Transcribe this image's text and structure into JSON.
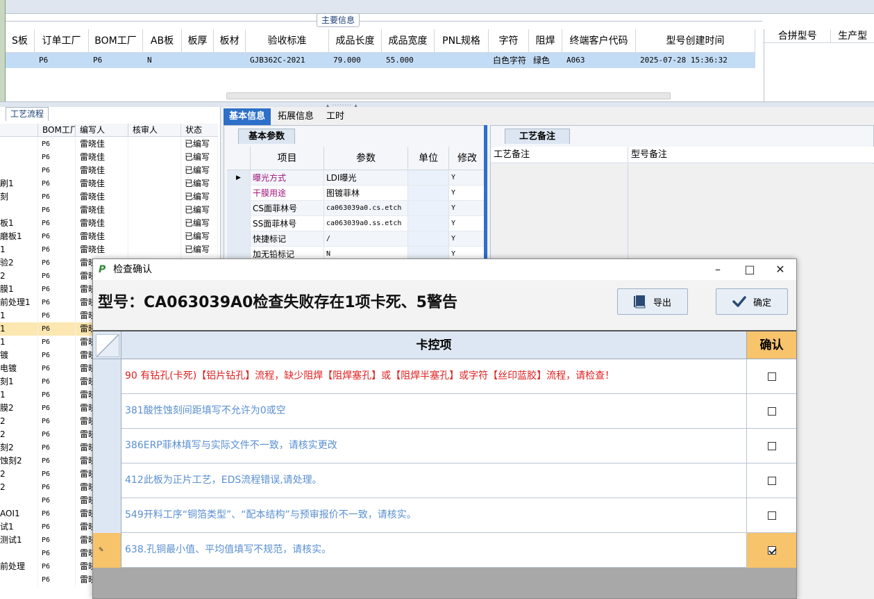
{
  "main_info": {
    "group_title": "主要信息",
    "headers": [
      "S板",
      "订单工厂",
      "BOM工厂",
      "AB板",
      "板厚",
      "板材",
      "验收标准",
      "成品长度",
      "成品宽度",
      "PNL规格",
      "字符",
      "阻焊",
      "终端客户代码",
      "型号创建时间"
    ],
    "row": [
      "",
      "P6",
      "P6",
      "N",
      "",
      "",
      "GJB362C-2021",
      "79.000",
      "55.000",
      "",
      "白色字符",
      "绿色",
      "A063",
      "2025-07-28 15:36:32"
    ],
    "right_headers": [
      "合拼型号",
      "生产型"
    ]
  },
  "process": {
    "tab": "工艺流程",
    "headers": [
      "",
      "BOM工厂",
      "编写人",
      "核审人",
      "状态"
    ],
    "rows": [
      [
        "",
        "P6",
        "雷晓佳",
        "",
        "已编写"
      ],
      [
        "",
        "P6",
        "雷晓佳",
        "",
        "已编写"
      ],
      [
        "",
        "P6",
        "雷晓佳",
        "",
        "已编写"
      ],
      [
        "刷1",
        "P6",
        "雷晓佳",
        "",
        "已编写"
      ],
      [
        "刻",
        "P6",
        "雷晓佳",
        "",
        "已编写"
      ],
      [
        "",
        "P6",
        "雷晓佳",
        "",
        "已编写"
      ],
      [
        "板1",
        "P6",
        "雷晓佳",
        "",
        "已编写"
      ],
      [
        "磨板1",
        "P6",
        "雷晓佳",
        "",
        "已编写"
      ],
      [
        "1",
        "P6",
        "雷晓佳",
        "",
        "已编写"
      ],
      [
        "验2",
        "P6",
        "雷晓",
        "",
        ""
      ],
      [
        "2",
        "P6",
        "雷晓",
        "",
        ""
      ],
      [
        "膜1",
        "P6",
        "雷晓",
        "",
        ""
      ],
      [
        "前处理1",
        "P6",
        "雷晓",
        "",
        ""
      ],
      [
        "1",
        "P6",
        "雷晓",
        "",
        ""
      ],
      [
        "1",
        "P6",
        "雷晓",
        "",
        ""
      ],
      [
        "1",
        "P6",
        "雷晓",
        "",
        ""
      ],
      [
        "镀",
        "P6",
        "雷晓",
        "",
        ""
      ],
      [
        "电镀",
        "P6",
        "雷晓",
        "",
        ""
      ],
      [
        "刻1",
        "P6",
        "雷晓",
        "",
        ""
      ],
      [
        "1",
        "P6",
        "雷晓",
        "",
        ""
      ],
      [
        "膜2",
        "P6",
        "雷晓",
        "",
        ""
      ],
      [
        "2",
        "P6",
        "雷晓",
        "",
        ""
      ],
      [
        "2",
        "P6",
        "雷晓",
        "",
        ""
      ],
      [
        "刻2",
        "P6",
        "雷晓",
        "",
        ""
      ],
      [
        "蚀刻2",
        "P6",
        "雷晓",
        "",
        ""
      ],
      [
        "2",
        "P6",
        "雷晓",
        "",
        ""
      ],
      [
        "2",
        "P6",
        "雷晓",
        "",
        ""
      ],
      [
        "",
        "P6",
        "雷晓",
        "",
        ""
      ],
      [
        "AOI1",
        "P6",
        "雷晓",
        "",
        ""
      ],
      [
        "试1",
        "P6",
        "雷晓",
        "",
        ""
      ],
      [
        "测试1",
        "P6",
        "雷晓",
        "",
        ""
      ],
      [
        "",
        "P6",
        "雷晓",
        "",
        ""
      ],
      [
        "前处理",
        "P6",
        "雷晓",
        "",
        ""
      ],
      [
        "",
        "P6",
        "雷晓",
        "",
        ""
      ]
    ]
  },
  "center": {
    "tabs": [
      "基本信息",
      "拓展信息",
      "工时"
    ],
    "subtab": "基本参数",
    "headers": [
      "项目",
      "参数",
      "单位",
      "修改"
    ],
    "rows": [
      [
        "曝光方式",
        "LDI曝光",
        "",
        "Y"
      ],
      [
        "干膜用途",
        "图镀菲林",
        "",
        "Y"
      ],
      [
        "CS面菲林号",
        "ca063039a0.cs.etch",
        "",
        "Y"
      ],
      [
        "SS面菲林号",
        "ca063039a0.ss.etch",
        "",
        "Y"
      ],
      [
        "快捷标记",
        "/",
        "",
        "Y"
      ],
      [
        "加无铅标记",
        "N",
        "",
        "Y"
      ]
    ]
  },
  "notes": {
    "tab": "工艺备注",
    "headers": [
      "工艺备注",
      "型号备注"
    ]
  },
  "dialog": {
    "title": "检查确认",
    "headline": "型号：CA063039A0检查失败存在1项卡死、5警告",
    "export_label": "导出",
    "ok_label": "确定",
    "col_item": "卡控项",
    "col_confirm": "确认",
    "items": [
      {
        "text": "90 有钻孔(卡死)【铝片钻孔】流程，缺少阻焊【阻焊塞孔】或【阻焊半塞孔】或字符【丝印蓝胶】流程，请检查！",
        "dead": true,
        "checked": false
      },
      {
        "text": "381酸性蚀刻间距填写不允许为0或空",
        "dead": false,
        "checked": false
      },
      {
        "text": "386ERP菲林填写与实际文件不一致，请核实更改",
        "dead": false,
        "checked": false
      },
      {
        "text": "412此板为正片工艺，EDS流程错误,请处理。",
        "dead": false,
        "checked": false
      },
      {
        "text": "549开料工序“铜箔类型”、“配本结构”与预审报价不一致，请核实。",
        "dead": false,
        "checked": false
      },
      {
        "text": "638.孔铜最小值、平均值填写不规范，请核实。",
        "dead": false,
        "checked": true
      }
    ],
    "colors": {
      "dead": "#e02020",
      "warn": "#5a8fd0",
      "accent": "#f7c36b"
    }
  }
}
